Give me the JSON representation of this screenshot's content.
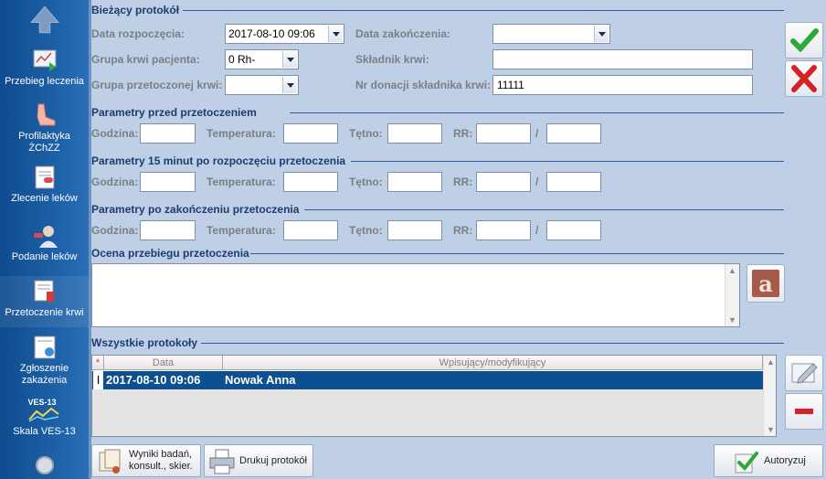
{
  "sidebar": {
    "items": [
      {
        "label": "Przebieg leczenia"
      },
      {
        "label": "Profilaktyka ŻChZZ"
      },
      {
        "label": "Zlecenie leków"
      },
      {
        "label": "Podanie leków"
      },
      {
        "label": "Przetoczenie krwi"
      },
      {
        "label": "Zgłoszenie zakażenia"
      },
      {
        "label": "Skala VES-13",
        "icon_text": "VES-13"
      }
    ]
  },
  "current": {
    "title": "Bieżący protokół",
    "start_label": "Data rozpoczęcia:",
    "start_value": "2017-08-10 09:06",
    "end_label": "Data zakończenia:",
    "end_value": "",
    "patient_blood_label": "Grupa krwi pacjenta:",
    "patient_blood_value": "0 Rh-",
    "component_label": "Składnik krwi:",
    "component_value": "",
    "transfused_label": "Grupa przetoczonej krwi:",
    "transfused_value": "",
    "donation_label": "Nr donacji składnika krwi:",
    "donation_value": "11111"
  },
  "params": {
    "labels": {
      "hour": "Godzina:",
      "temp": "Temperatura:",
      "pulse": "Tętno:",
      "rr": "RR:",
      "slash": "/"
    },
    "before": {
      "title": "Parametry przed przetoczeniem"
    },
    "after15": {
      "title": "Parametry 15 minut po rozpoczęciu przetoczenia"
    },
    "after": {
      "title": "Parametry po zakończeniu przetoczenia"
    }
  },
  "assessment": {
    "title": "Ocena przebiegu przetoczenia",
    "value": ""
  },
  "protocols": {
    "title": "Wszystkie protokoły",
    "columns": {
      "marker": "*",
      "date": "Data",
      "author": "Wpisujący/modyfikujący"
    },
    "rows": [
      {
        "marker": "I",
        "date": "2017-08-10 09:06",
        "author": "Nowak Anna"
      }
    ]
  },
  "buttons": {
    "results": "Wyniki badań, konsult., skier.",
    "print": "Drukuj protokół",
    "authorize": "Autoryzuj"
  },
  "colors": {
    "sidebar": "#1f63aa",
    "panel": "#bfcfe5",
    "selection": "#0e4f8f",
    "ok": "#2fa83a",
    "cancel": "#d8202a"
  }
}
